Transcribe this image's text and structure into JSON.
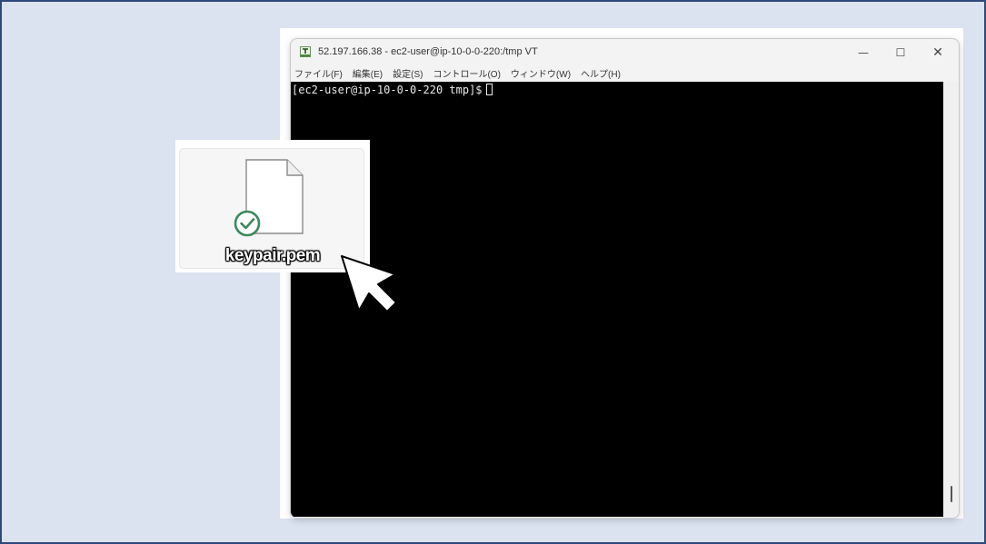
{
  "window": {
    "title": "52.197.166.38 - ec2-user@ip-10-0-0-220:/tmp VT",
    "app_icon": "teraterm-icon",
    "controls": {
      "minimize": "—",
      "maximize": "☐",
      "close": "✕"
    }
  },
  "menu": [
    {
      "label": "ファイル(F)"
    },
    {
      "label": "編集(E)"
    },
    {
      "label": "設定(S)"
    },
    {
      "label": "コントロール(O)"
    },
    {
      "label": "ウィンドウ(W)"
    },
    {
      "label": "ヘルプ(H)"
    }
  ],
  "terminal": {
    "prompt": "[ec2-user@ip-10-0-0-220 tmp]$",
    "background": "#000000",
    "text_color": "#eaeaea"
  },
  "file": {
    "name": "keypair.pem",
    "icon": "document-icon",
    "status_icon": "sync-check-icon",
    "status_color": "#3a8a5a"
  },
  "cursor_icon": "mouse-pointer-icon",
  "colors": {
    "page_background": "#dbe3f1",
    "frame_border": "#2d4a7a"
  }
}
